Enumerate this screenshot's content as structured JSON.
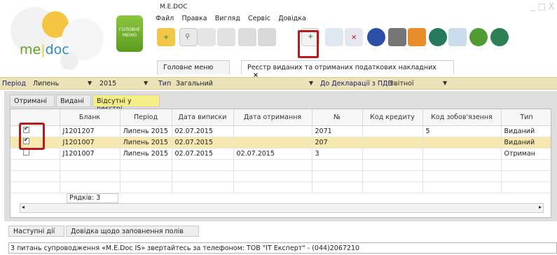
{
  "app": {
    "title": "M.E.DOC",
    "logo": {
      "me": "me",
      "doc": "doc"
    },
    "main_menu_button": "ГОЛОВНЕ МЕНЮ"
  },
  "menubar": [
    "Файл",
    "Правка",
    "Вигляд",
    "Сервіс",
    "Довідка"
  ],
  "window_controls": "_ □ X",
  "toolbar_icons": [
    "add-document-icon",
    "search-icon",
    "delete-icon",
    "copy-icon",
    "edit-icon",
    "print-preview-icon",
    "new-record-icon",
    "list-icon",
    "delete-list-icon",
    "globe-icon",
    "printer-icon",
    "gear-icon",
    "stamp-icon",
    "check-icon",
    "refresh-icon",
    "shield-icon"
  ],
  "tabs": [
    {
      "label": "Головне меню"
    },
    {
      "label": "Реєстр виданих та отриманих податкових накладних",
      "close": "×"
    }
  ],
  "filter": {
    "period_label": "Період",
    "period_month": "Липень",
    "period_year": "2015",
    "type_label": "Тип",
    "type_value": "Загальний",
    "to_declaration_label": "До Декларації з ПДВ",
    "to_declaration_value": "Звітної"
  },
  "subtabs": [
    "Отримані",
    "Видані",
    "Відсутні у реєстрі"
  ],
  "table": {
    "headers": [
      "",
      "Бланк",
      "Період",
      "Дата виписки",
      "Дата отримання",
      "№",
      "Код кредиту",
      "Код зобов'язення",
      "Тип"
    ],
    "rows": [
      {
        "checked": true,
        "blank": "J1201207",
        "period": "Липень 2015",
        "date_issue": "02.07.2015",
        "date_receive": "",
        "num": "2071",
        "credit": "",
        "obligation": "5",
        "type": "Виданий"
      },
      {
        "checked": true,
        "blank": "J1201007",
        "period": "Липень 2015",
        "date_issue": "02.07.2015",
        "date_receive": "",
        "num": "207",
        "credit": "",
        "obligation": "",
        "type": "Виданий"
      },
      {
        "checked": false,
        "blank": "J1201007",
        "period": "Липень 2015",
        "date_issue": "02.07.2015",
        "date_receive": "02.07.2015",
        "num": "3",
        "credit": "",
        "obligation": "",
        "type": "Отриман"
      }
    ],
    "rows_count": "Рядків: 3"
  },
  "bottom_tabs": [
    "Наступні дії",
    "Довідка щодо заповнення полів"
  ],
  "status": "3 питань супроводження «M.E.Doc IS» звертайтесь за телефоном: ТОВ \"IT Експерт\" - (044)2067210",
  "colors": {
    "filter_bg": "#ece2b8",
    "selected_row": "#f7e8b0",
    "highlight": "#b81b1b",
    "accent_green": "#6aa226"
  }
}
